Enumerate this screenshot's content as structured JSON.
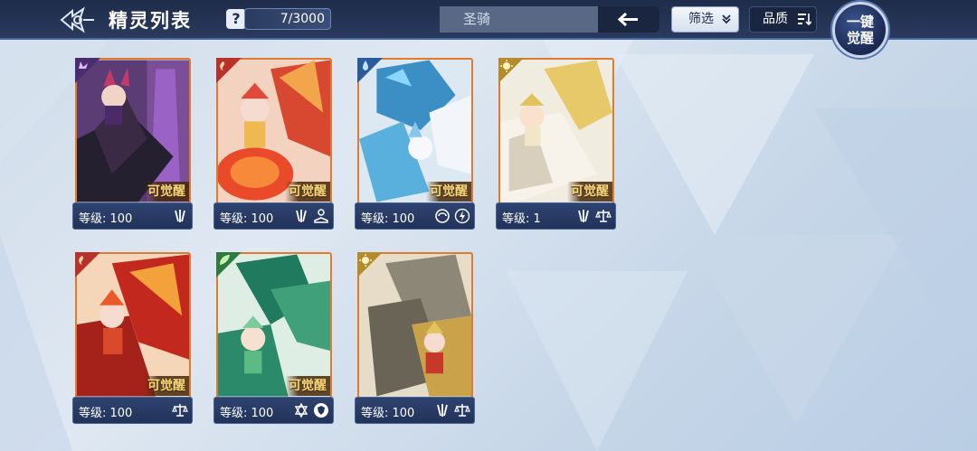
{
  "header": {
    "title": "精灵列表",
    "help_label": "?",
    "count": "7/3000",
    "search_value": "圣骑",
    "filter_label": "筛选",
    "quality_label": "品质",
    "awaken_all_label_1": "一键",
    "awaken_all_label_2": "觉醒"
  },
  "cards": [
    {
      "level": "等级: 100",
      "awaken": "可觉醒",
      "element": "shadow-element-icon",
      "skills": [
        "claw-skill-icon"
      ]
    },
    {
      "level": "等级: 100",
      "awaken": "可觉醒",
      "element": "fire-element-icon",
      "skills": [
        "claw-skill-icon",
        "book-skill-icon"
      ]
    },
    {
      "level": "等级: 100",
      "awaken": "可觉醒",
      "element": "water-element-icon",
      "skills": [
        "swirl-skill-icon",
        "lightning-skill-icon"
      ]
    },
    {
      "level": "等级: 1",
      "awaken": "可觉醒",
      "element": "light-element-icon",
      "skills": [
        "claw-skill-icon",
        "scale-skill-icon"
      ]
    },
    {
      "level": "等级: 100",
      "awaken": "可觉醒",
      "element": "fire-element-icon",
      "skills": [
        "scale-skill-icon"
      ]
    },
    {
      "level": "等级: 100",
      "awaken": "可觉醒",
      "element": "grass-element-icon",
      "skills": [
        "star-skill-icon",
        "shield-skill-icon"
      ]
    },
    {
      "level": "等级: 100",
      "awaken": "",
      "element": "light-element-icon",
      "skills": [
        "claw-skill-icon",
        "scale-skill-icon"
      ]
    }
  ],
  "colors": {
    "topbar": "#1f2c4a",
    "card_border": "#e07a2c",
    "awaken_text": "#f6d77a"
  }
}
